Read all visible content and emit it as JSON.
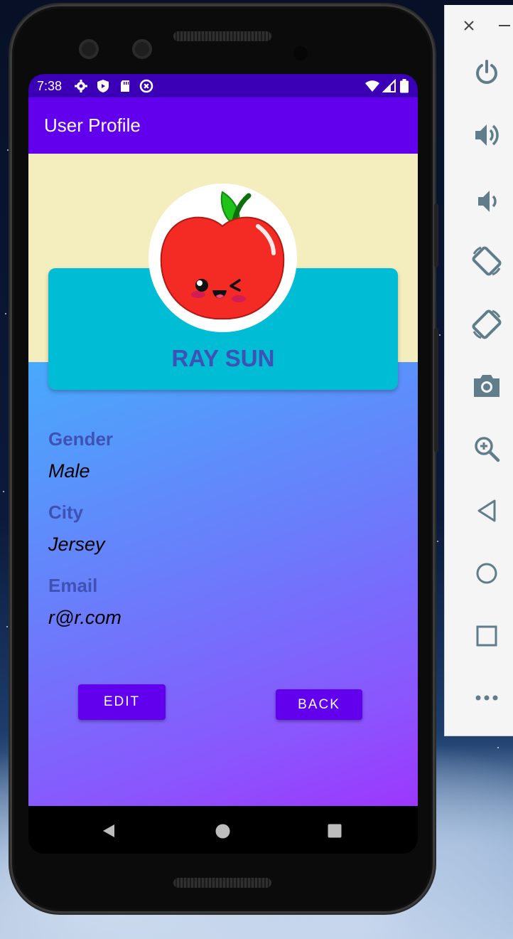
{
  "status_bar": {
    "time": "7:38",
    "icons": [
      "settings-icon",
      "shield-icon",
      "sd-card-icon",
      "data-saver-icon",
      "wifi-icon",
      "signal-icon",
      "battery-icon"
    ]
  },
  "app_bar": {
    "title": "User Profile"
  },
  "profile": {
    "name": "RAY SUN",
    "avatar": "apple-avatar-icon"
  },
  "fields": [
    {
      "label": "Gender",
      "value": "Male"
    },
    {
      "label": "City",
      "value": "Jersey"
    },
    {
      "label": "Email",
      "value": "r@r.com"
    }
  ],
  "buttons": {
    "edit": "EDIT",
    "back": "BACK"
  },
  "nav_bar": {
    "icons": [
      "back-triangle-icon",
      "home-circle-icon",
      "recents-square-icon"
    ]
  },
  "emulator_toolbar": {
    "items": [
      "close-icon",
      "minimize-icon",
      "power-icon",
      "volume-up-icon",
      "volume-down-icon",
      "rotate-left-icon",
      "rotate-right-icon",
      "camera-icon",
      "zoom-icon",
      "back-icon",
      "home-icon",
      "overview-icon",
      "more-icon"
    ]
  },
  "colors": {
    "primary": "#6200ee",
    "primary_dark": "#3700b3",
    "card": "#00bcd4",
    "label": "#3f51b5",
    "cream": "#f4edbd"
  }
}
